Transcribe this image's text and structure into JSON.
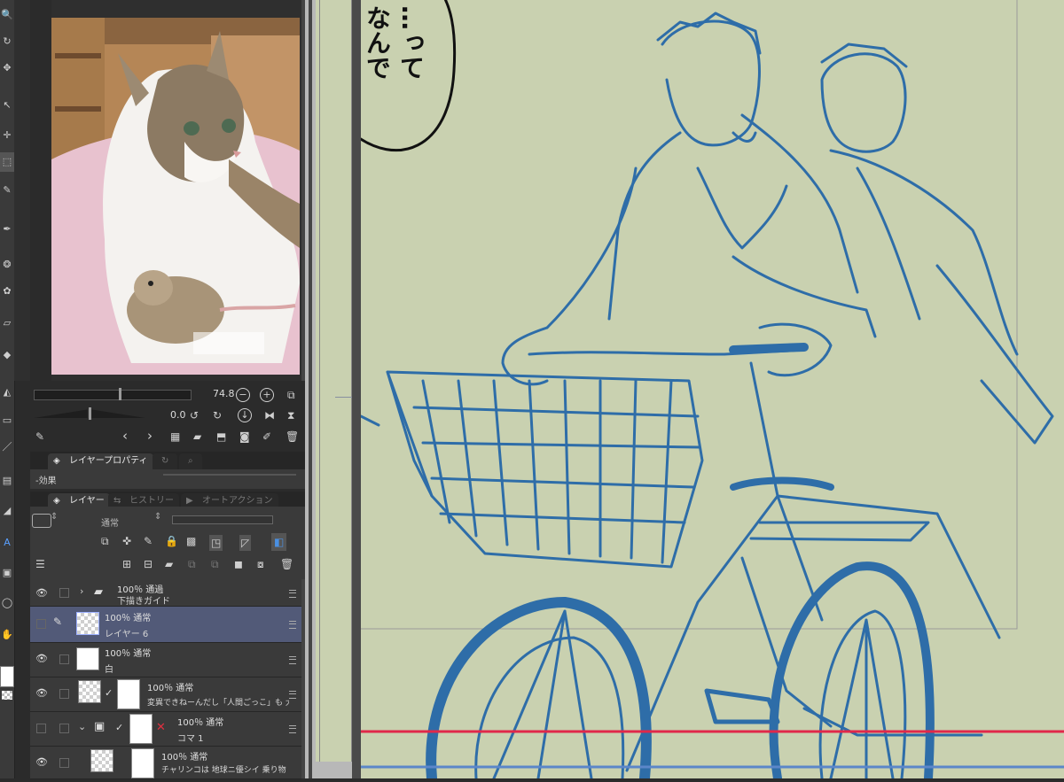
{
  "navigator": {
    "zoom_value": "74.8",
    "rotate_value": "0.0"
  },
  "property_panel": {
    "tab_label": "レイヤープロパティ",
    "effect_label": "-効果"
  },
  "layer_panel": {
    "tabs": [
      {
        "label": "レイヤー"
      },
      {
        "label": "ヒストリー"
      },
      {
        "label": "オートアクション"
      }
    ],
    "blend_mode": "通常",
    "layers": [
      {
        "opacity_mode": "100％ 通過",
        "name": "下描きガイド",
        "type": "folder"
      },
      {
        "opacity_mode": "100％ 通常",
        "name": "レイヤー 6",
        "type": "raster",
        "selected": true
      },
      {
        "opacity_mode": "100％ 通常",
        "name": "白",
        "type": "raster"
      },
      {
        "opacity_mode": "100％ 通常",
        "name": "変異できねーんだし「人間ごっこ」も 大概に",
        "type": "text"
      },
      {
        "opacity_mode": "100％ 通常",
        "name": "コマ 1",
        "type": "frame"
      },
      {
        "opacity_mode": "100％ 通常",
        "name": "チャリンコは 地球ニ優シイ 乗り物",
        "type": "text"
      }
    ]
  },
  "canvas": {
    "speech_bubble_lines": [
      "…って",
      "なんで"
    ],
    "background_color": "#c9d1b0",
    "line_color": "#2e6da8",
    "red_guide_color": "#e0284a"
  }
}
